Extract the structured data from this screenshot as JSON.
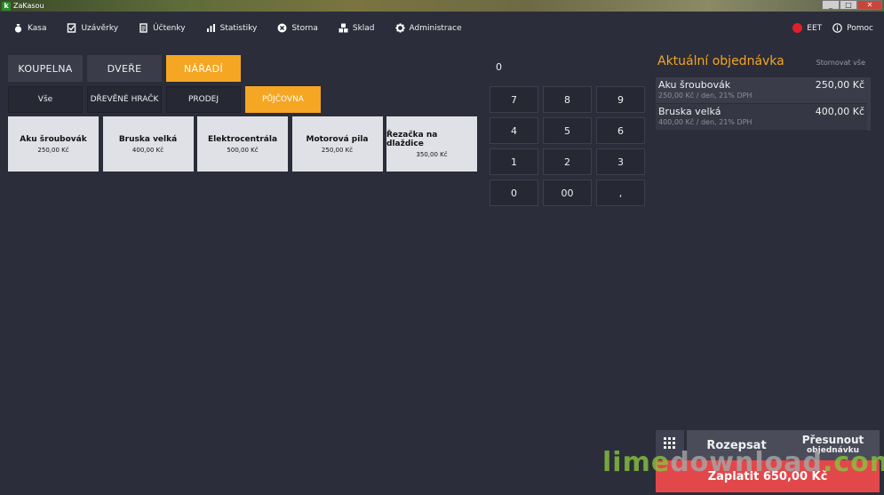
{
  "window": {
    "title": "ZaKasou",
    "logo_letter": "k",
    "controls": [
      "_",
      "□",
      "✕"
    ]
  },
  "menu": {
    "items": [
      {
        "label": "Kasa",
        "icon": "money-bag-icon"
      },
      {
        "label": "Uzávěrky",
        "icon": "checkbox-icon"
      },
      {
        "label": "Účtenky",
        "icon": "receipt-icon"
      },
      {
        "label": "Statistiky",
        "icon": "bar-chart-icon"
      },
      {
        "label": "Storna",
        "icon": "cancel-circle-icon"
      },
      {
        "label": "Sklad",
        "icon": "boxes-icon"
      },
      {
        "label": "Administrace",
        "icon": "gear-icon"
      }
    ],
    "eet_label": "EET",
    "eet_status_color": "#e0202a",
    "help_label": "Pomoc"
  },
  "categories": [
    {
      "label": "KOUPELNA",
      "active": false
    },
    {
      "label": "DVEŘE",
      "active": false
    },
    {
      "label": "NÁŘADÍ",
      "active": true
    }
  ],
  "subcategories": [
    {
      "label": "Vše",
      "active": false
    },
    {
      "label": "DŘEVĚNÉ HRAČK",
      "active": false
    },
    {
      "label": "PRODEJ",
      "active": false
    },
    {
      "label": "PŮJČOVNA",
      "active": true
    }
  ],
  "products": [
    {
      "name": "Aku šroubovák",
      "price": "250,00 Kč"
    },
    {
      "name": "Bruska velká",
      "price": "400,00 Kč"
    },
    {
      "name": "Elektrocentrála",
      "price": "500,00 Kč"
    },
    {
      "name": "Motorová pila",
      "price": "250,00 Kč"
    },
    {
      "name": "Řezačka na dlaždice",
      "price": "350,00 Kč"
    }
  ],
  "keypad": {
    "display": "0",
    "keys": [
      "7",
      "8",
      "9",
      "4",
      "5",
      "6",
      "1",
      "2",
      "3",
      "0",
      "00",
      ","
    ]
  },
  "order": {
    "title": "Aktuální objednávka",
    "cancel_all": "Stornovat vše",
    "items": [
      {
        "name": "Aku šroubovák",
        "price": "250,00 Kč",
        "detail": "250,00 Kč / den, 21% DPH"
      },
      {
        "name": "Bruska velká",
        "price": "400,00 Kč",
        "detail": "400,00 Kč / den, 21% DPH"
      }
    ],
    "split_label": "Rozepsat",
    "move_label_1": "Přesunout",
    "move_label_2": "objednávku",
    "pay_label": "Zaplatit 650,00 Kč"
  },
  "watermark": {
    "part1": "lime",
    "part2": "download",
    "part3": ".com"
  },
  "colors": {
    "accent": "#f5a623",
    "pay": "#e2474a",
    "background": "#2b2d3a"
  }
}
